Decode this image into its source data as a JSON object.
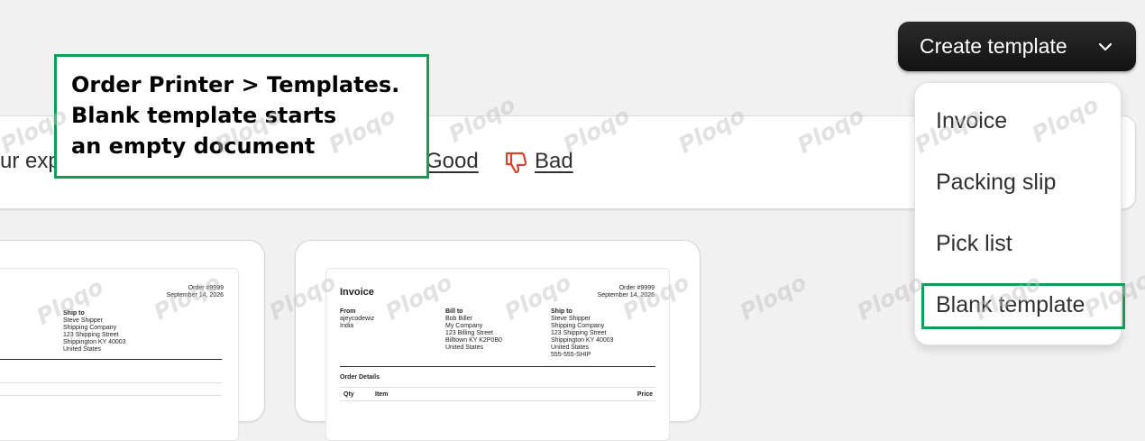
{
  "feedback": {
    "text": "ur exp",
    "good_label": "Good",
    "bad_label": "Bad"
  },
  "create_button": {
    "label": "Create template"
  },
  "menu": {
    "items": [
      {
        "label": "Invoice"
      },
      {
        "label": "Packing slip"
      },
      {
        "label": "Pick list"
      },
      {
        "label": "Blank template"
      }
    ]
  },
  "callout": {
    "lines": [
      "Order Printer > Templates.",
      "Blank template starts",
      "an empty document"
    ]
  },
  "card1": {
    "order_no": "Order #9999",
    "date": "September 14, 2026",
    "ship_to_heading": "Ship to",
    "ship_to": [
      "Steve Shipper",
      "Shipping Company",
      "123 Shipping Street",
      "Shippington KY 40003",
      "United States"
    ]
  },
  "card2": {
    "title": "Invoice",
    "order_no": "Order #9999",
    "date": "September 14, 2026",
    "from_heading": "From",
    "from": [
      "ajeycodewiz",
      "India"
    ],
    "bill_to_heading": "Bill to",
    "bill_to": [
      "Bob Biller",
      "My Company",
      "123 Billing Street",
      "Billtown KY K2P0B0",
      "United States"
    ],
    "ship_to_heading": "Ship to",
    "ship_to": [
      "Steve Shipper",
      "Shipping Company",
      "123 Shipping Street",
      "Shippington KY 40003",
      "United States",
      "555-555-SHIP"
    ],
    "order_details_heading": "Order Details",
    "table_headers": [
      "Qty",
      "Item",
      "Price"
    ]
  },
  "watermark": {
    "text": "Ploqo"
  },
  "colors": {
    "highlight": "#0f9d58",
    "bad_icon": "#d8432b",
    "button_bg": "#1a1a1a"
  }
}
